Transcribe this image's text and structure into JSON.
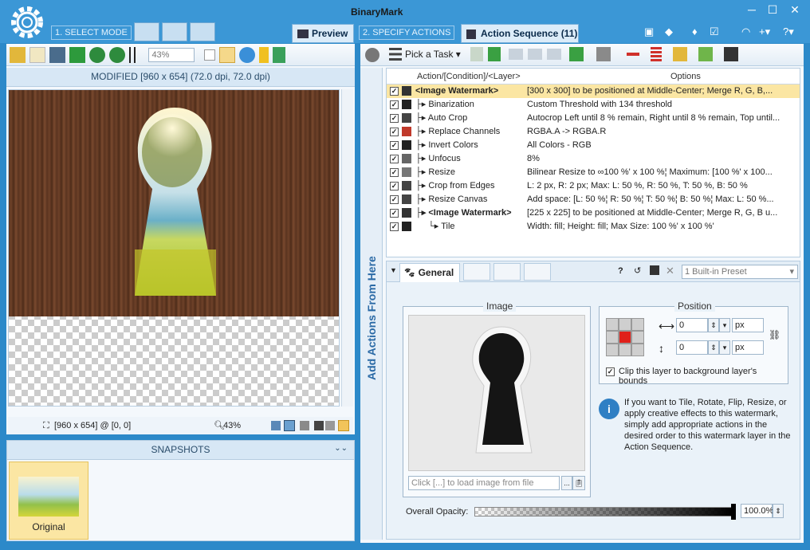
{
  "app": {
    "brand": "BinaryMark"
  },
  "steps": {
    "select_mode": "1. SELECT MODE",
    "specify_actions": "2. SPECIFY ACTIONS",
    "preview": "Preview",
    "action_sequence": "Action Sequence (11)"
  },
  "left": {
    "zoom": "43%",
    "header": "MODIFIED [960 x 654] (72.0 dpi, 72.0 dpi)",
    "status_size": "[960 x 654] @ [0, 0]",
    "status_zoom": "43%",
    "snapshots": "SNAPSHOTS",
    "snapshot_label": "Original"
  },
  "right": {
    "pick_task": "Pick a Task",
    "col_action": "Action/[Condition]/<Layer>",
    "col_options": "Options",
    "side_label": "Add Actions From Here",
    "rows": [
      {
        "name": "<Image Watermark>",
        "options": "[300 x 300] to be positioned at Middle-Center; Merge R, G, B,...",
        "indent": "",
        "bold": true
      },
      {
        "name": "Binarization",
        "options": "Custom Threshold with 134 threshold",
        "indent": "├▸ ",
        "bold": false
      },
      {
        "name": "Auto Crop",
        "options": "Autocrop Left until 8 % remain, Right until 8 % remain, Top until...",
        "indent": "├▸ ",
        "bold": false
      },
      {
        "name": "Replace Channels",
        "options": "RGBA.A -> RGBA.R",
        "indent": "├▸ ",
        "bold": false
      },
      {
        "name": "Invert Colors",
        "options": "All Colors - RGB",
        "indent": "├▸ ",
        "bold": false
      },
      {
        "name": "Unfocus",
        "options": "8%",
        "indent": "├▸ ",
        "bold": false
      },
      {
        "name": "Resize",
        "options": "Bilinear Resize to ∞100 %' x 100 %¦ Maximum: [100 %' x 100...",
        "indent": "├▸ ",
        "bold": false
      },
      {
        "name": "Crop from Edges",
        "options": "L: 2 px, R: 2 px; Max: L: 50 %, R: 50 %, T: 50 %, B: 50 %",
        "indent": "├▸ ",
        "bold": false
      },
      {
        "name": "Resize Canvas",
        "options": "Add space: [L: 50 %¦ R: 50 %¦ T: 50 %¦ B: 50 %¦ Max: L: 50 %...",
        "indent": "├▸ ",
        "bold": false
      },
      {
        "name": "<Image Watermark>",
        "options": "[225 x 225] to be positioned at Middle-Center; Merge R, G, B u...",
        "indent": "├▸ ",
        "bold": true
      },
      {
        "name": "Tile",
        "options": "Width: fill; Height: fill; Max Size: 100 %' x 100 %'",
        "indent": "└▸ ",
        "bold": false
      }
    ],
    "tab_general": "General",
    "preset": "1 Built-in Preset",
    "image_group": "Image",
    "position_group": "Position",
    "x_value": "0",
    "y_value": "0",
    "unit": "px",
    "clip_label": "Clip this layer to background layer's bounds",
    "info_text": "If you want to Tile, Rotate, Flip, Resize, or apply creative effects to this watermark, simply add appropriate actions in the desired order to this watermark layer in the Action Sequence.",
    "file_placeholder": "Click [...] to load image from file",
    "opacity_label": "Overall Opacity:",
    "opacity_value": "100.0%"
  }
}
